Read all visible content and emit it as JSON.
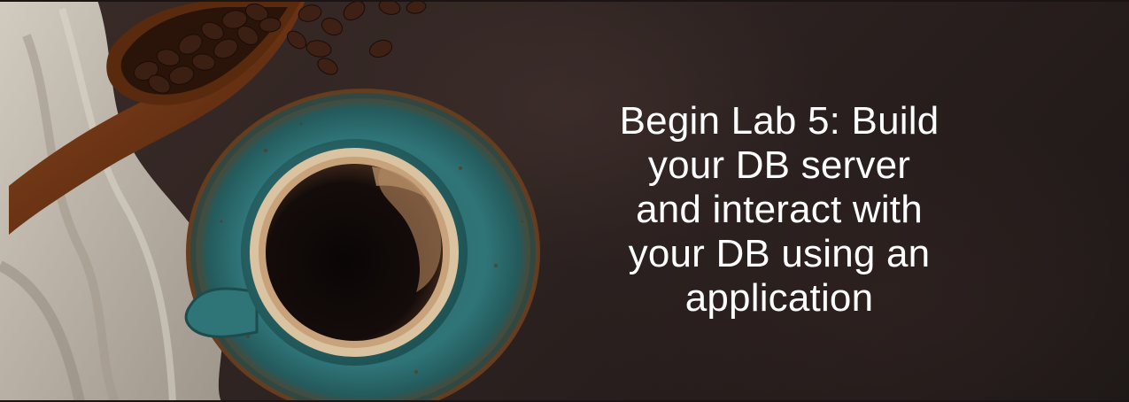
{
  "slide": {
    "title": "Begin Lab 5: Build your DB server and interact with your DB using an application"
  },
  "image": {
    "description_icon": "coffee-cup-photo",
    "colors": {
      "background": "#2a201e",
      "cup_glaze": "#2f6f73",
      "saucer_rim": "#8a4a1e",
      "coffee": "#0f0a09",
      "crema": "#c8a27a",
      "wood_scoop": "#6a3314",
      "beans": "#3b1f12",
      "cloth": "#bfb7ab"
    }
  }
}
